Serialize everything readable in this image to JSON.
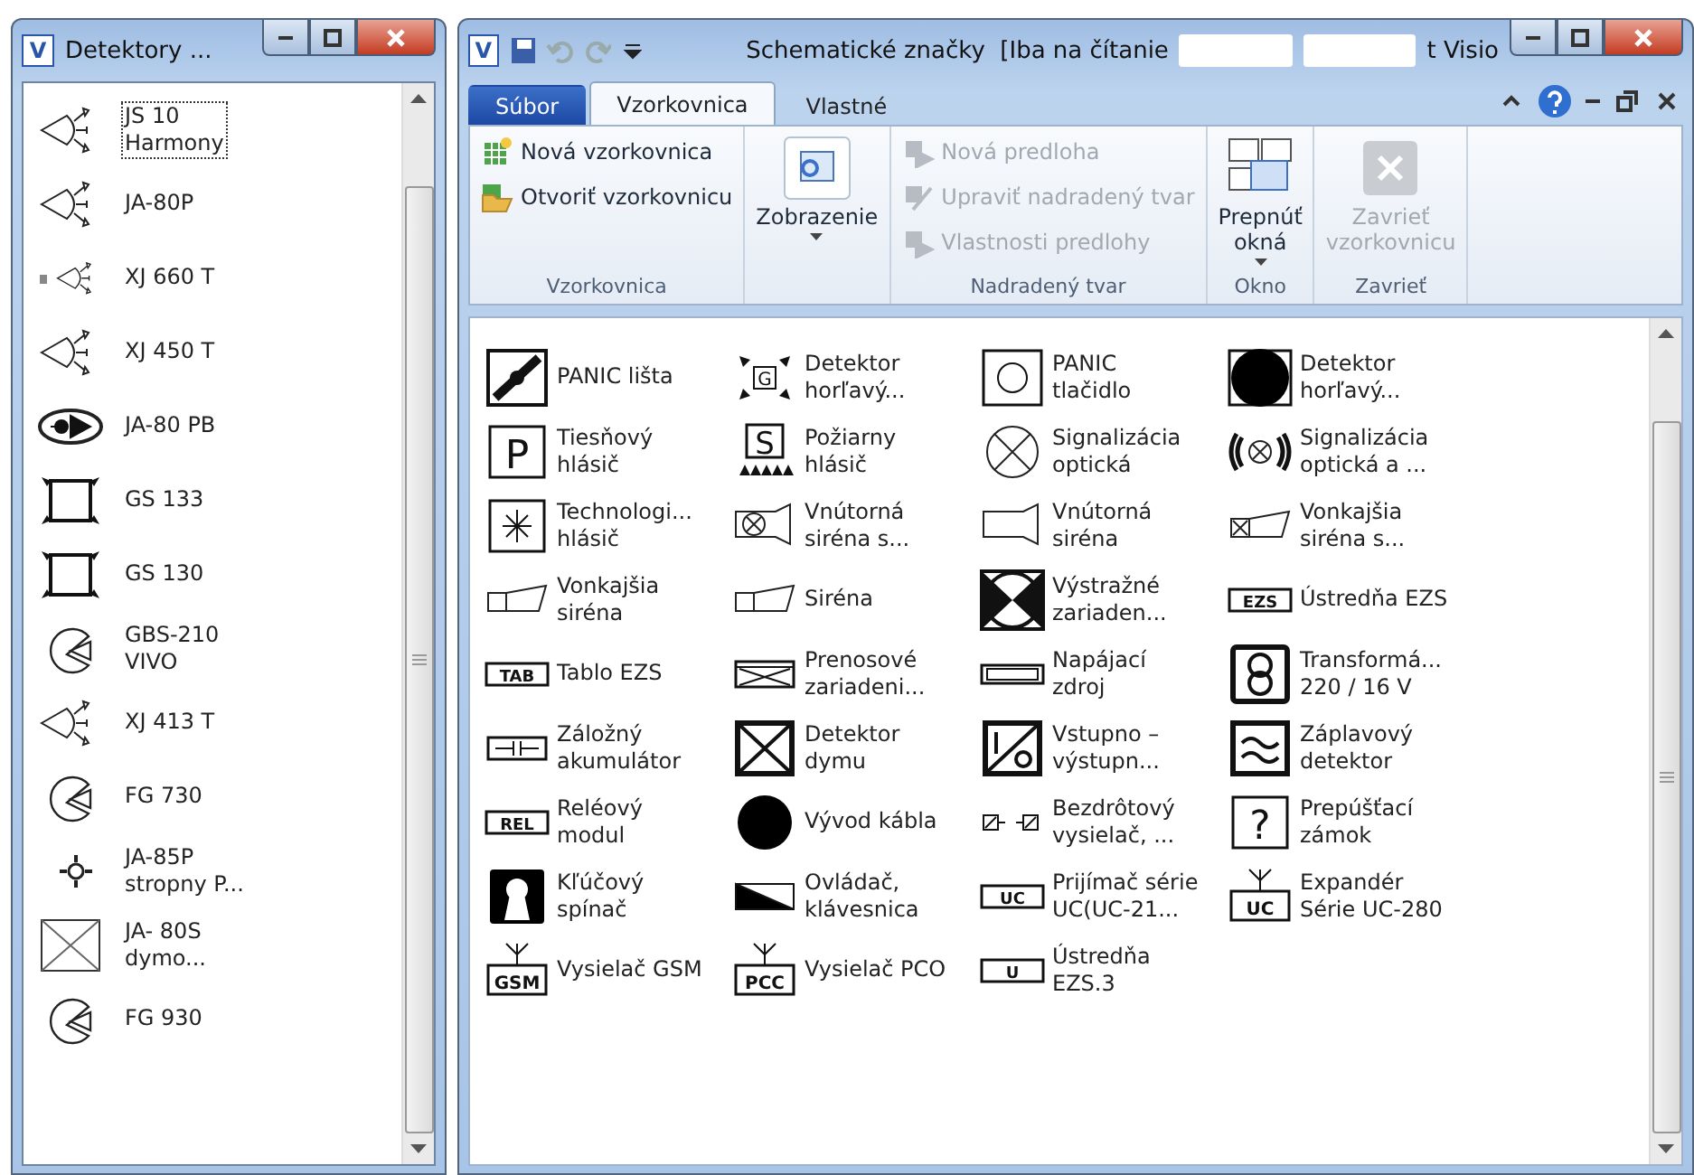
{
  "stencil_window": {
    "logo": "V",
    "title": "Detektory ...",
    "items": [
      {
        "label": "JS 10\nHarmony",
        "kind": "detector",
        "selected": true
      },
      {
        "label": "JA-80P",
        "kind": "detector",
        "selected": false
      },
      {
        "label": "XJ 660 T",
        "kind": "detector-small",
        "selected": false
      },
      {
        "label": "XJ 450 T",
        "kind": "detector",
        "selected": false
      },
      {
        "label": "JA-80 PB",
        "kind": "eye",
        "selected": false
      },
      {
        "label": "GS 133",
        "kind": "square-arrows",
        "selected": false
      },
      {
        "label": "GS 130",
        "kind": "square-arrows",
        "selected": false
      },
      {
        "label": "GBS-210\nVIVO",
        "kind": "pacman",
        "selected": false
      },
      {
        "label": "XJ 413 T",
        "kind": "detector",
        "selected": false
      },
      {
        "label": "FG 730",
        "kind": "pacman",
        "selected": false
      },
      {
        "label": "JA-85P\nstropny P...",
        "kind": "ceiling",
        "selected": false
      },
      {
        "label": "JA- 80S\ndymo...",
        "kind": "box-x",
        "selected": false
      },
      {
        "label": "FG 930",
        "kind": "pacman",
        "selected": false
      }
    ]
  },
  "main_window": {
    "logo": "V",
    "title": "Schematické značky  [Iba na čítanie",
    "title_end": "t Visio",
    "tabs": [
      {
        "label": "Súbor",
        "kind": "file",
        "selected": false
      },
      {
        "label": "Vzorkovnica",
        "kind": "tab",
        "selected": true
      },
      {
        "label": "Vlastné",
        "kind": "tab",
        "selected": false
      }
    ],
    "ribbon": [
      {
        "group": "Vzorkovnica",
        "kind": "list",
        "buttons": [
          {
            "label": "Nová vzorkovnica",
            "disabled": false
          },
          {
            "label": "Otvoriť vzorkovnicu",
            "disabled": false
          }
        ]
      },
      {
        "kind": "big",
        "buttons": [
          {
            "label": "Zobrazenie",
            "disabled": false,
            "dropdown": true
          }
        ]
      },
      {
        "group": "Nadradený tvar",
        "kind": "list",
        "buttons": [
          {
            "label": "Nová predloha",
            "disabled": true
          },
          {
            "label": "Upraviť nadradený tvar",
            "disabled": true
          },
          {
            "label": "Vlastnosti predlohy",
            "disabled": true
          }
        ]
      },
      {
        "group": "Okno",
        "kind": "big",
        "buttons": [
          {
            "label": "Prepnúť\nokná",
            "disabled": false,
            "dropdown": true
          }
        ]
      },
      {
        "group": "Zavrieť",
        "kind": "big",
        "buttons": [
          {
            "label": "Zavrieť\nvzorkovnicu",
            "disabled": true
          }
        ]
      }
    ],
    "shapes": [
      {
        "label": "PANIC lišta",
        "kind": "panic-bar"
      },
      {
        "label": "Detektor\nhorľavý...",
        "kind": "gas",
        "tag": "G"
      },
      {
        "label": "PANIC\ntlačidlo",
        "kind": "circle-box"
      },
      {
        "label": "Detektor\nhorľavý...",
        "kind": "filled-box"
      },
      {
        "label": "Tiesňový\nhlásič",
        "kind": "letter-box",
        "tag": "P"
      },
      {
        "label": "Požiarny\nhlásič",
        "kind": "fire",
        "tag": "S"
      },
      {
        "label": "Signalizácia\noptická",
        "kind": "circle-x"
      },
      {
        "label": "Signalizácia\noptická a ...",
        "kind": "sound-x"
      },
      {
        "label": "Technologi...\nhlásič",
        "kind": "star-box"
      },
      {
        "label": "Vnútorná\nsiréna s...",
        "kind": "camera-x"
      },
      {
        "label": "Vnútorná\nsiréna",
        "kind": "camera"
      },
      {
        "label": "Vonkajšia\nsiréna s...",
        "kind": "horn-x"
      },
      {
        "label": "Vonkajšia\nsiréna",
        "kind": "horn"
      },
      {
        "label": "Siréna",
        "kind": "horn"
      },
      {
        "label": "Výstražné\nzariaden...",
        "kind": "bowtie"
      },
      {
        "label": "Ústredňa EZS",
        "kind": "tag",
        "tag": "EZS"
      },
      {
        "label": "Tablo EZS",
        "kind": "tag",
        "tag": "TAB"
      },
      {
        "label": "Prenosové\nzariadeni...",
        "kind": "envelope"
      },
      {
        "label": "Napájací\nzdroj",
        "kind": "supply"
      },
      {
        "label": "Transformá...\n220 / 16 V",
        "kind": "transformer"
      },
      {
        "label": "Záložný\nakumulátor",
        "kind": "battery"
      },
      {
        "label": "Detektor\ndymu",
        "kind": "smoke"
      },
      {
        "label": "Vstupno –\nvýstupn...",
        "kind": "io"
      },
      {
        "label": "Záplavový\ndetektor",
        "kind": "waves"
      },
      {
        "label": "Reléový\nmodul",
        "kind": "tag",
        "tag": "REL"
      },
      {
        "label": "Vývod kábla",
        "kind": "dot"
      },
      {
        "label": "Bezdrôtový\nvysielač, ...",
        "kind": "wireless"
      },
      {
        "label": "Prepúšťací\nzámok",
        "kind": "letter-box",
        "tag": "?"
      },
      {
        "label": "Kľúčový\nspínač",
        "kind": "keyhole"
      },
      {
        "label": "Ovládač,\nklávesnica",
        "kind": "wedge"
      },
      {
        "label": "Prijímač série\nUC(UC-21...",
        "kind": "tag",
        "tag": "UC"
      },
      {
        "label": "Expandér\nSérie UC-280",
        "kind": "antenna",
        "tag": "UC"
      },
      {
        "label": "Vysielač GSM",
        "kind": "antenna",
        "tag": "GSM"
      },
      {
        "label": "Vysielač PCO",
        "kind": "antenna",
        "tag": "PCC"
      },
      {
        "label": "Ústredňa\nEZS.3",
        "kind": "tag",
        "tag": "U"
      }
    ]
  }
}
